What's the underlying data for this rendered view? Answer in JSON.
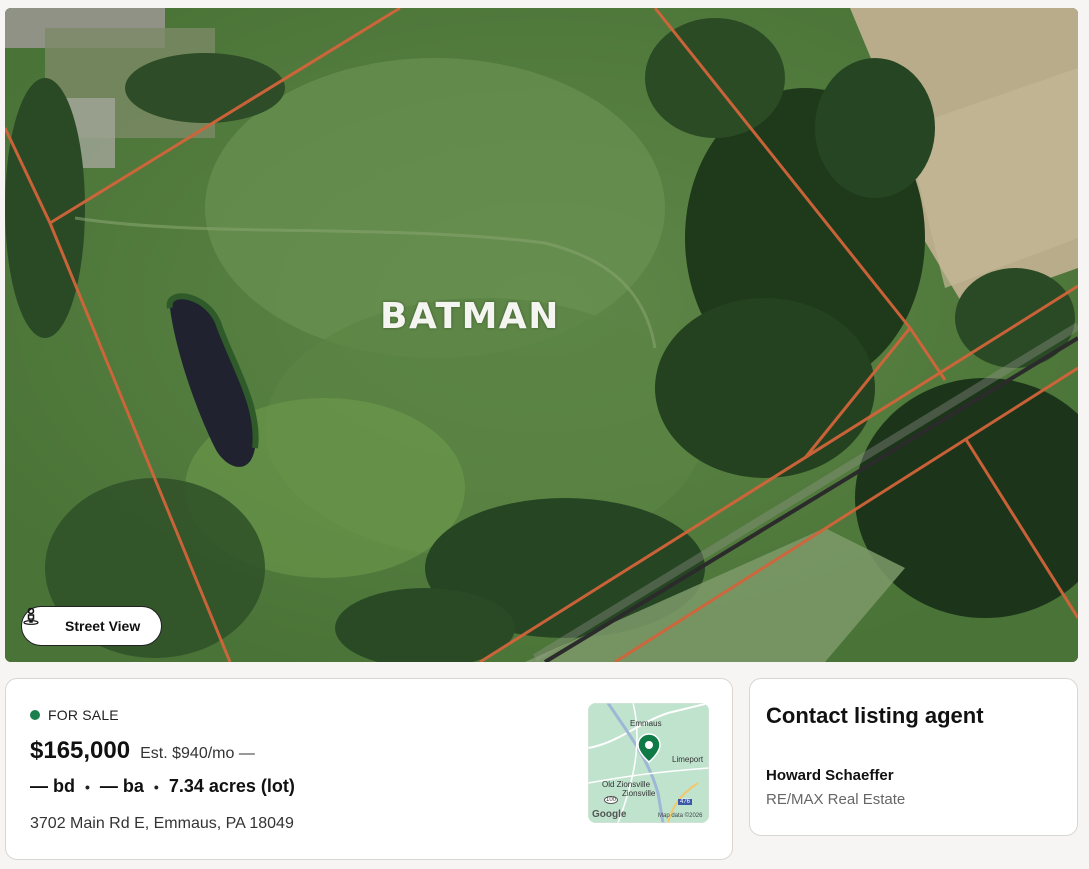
{
  "map": {
    "overlay_text": "BATMAN",
    "street_view_label": "Street View"
  },
  "listing": {
    "status": "FOR SALE",
    "status_color": "#1b7f4d",
    "price": "$165,000",
    "estimate": "Est. $940/mo —",
    "beds": "— bd",
    "baths": "— ba",
    "lot": "7.34 acres (lot)",
    "separator": "•",
    "address": "3702 Main Rd E, Emmaus, PA 18049"
  },
  "minimap": {
    "labels": {
      "emmaus": "Emmaus",
      "limeport": "Limeport",
      "old_zionsville": "Old Zionsville",
      "zionsville": "Zionsville",
      "route_100": "100",
      "route_476": "476",
      "google": "Google",
      "map_data": "Map data ©2026"
    }
  },
  "agent": {
    "title": "Contact listing agent",
    "name": "Howard Schaeffer",
    "company": "RE/MAX Real Estate"
  }
}
